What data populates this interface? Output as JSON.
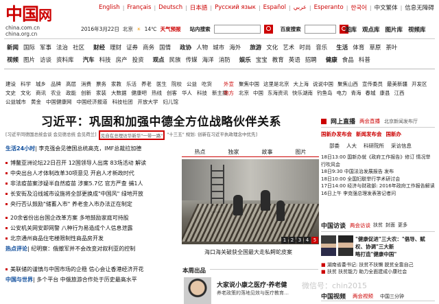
{
  "langbar": [
    "English",
    "Français",
    "Deutsch",
    "日本語",
    "Русский язык",
    "Español",
    "عربي",
    "Esperanto",
    "한국어",
    "中文繁体",
    "信息无障碍"
  ],
  "logo": {
    "main": "中国",
    "net": "网",
    "sub1": "china.com.cn",
    "sub2": "china.org.cn"
  },
  "datebar": {
    "date": "2016年3月22日",
    "city": "北京",
    "temp": "14℃",
    "weather": "天气预报",
    "site_search_label": "站内搜索",
    "baidu_label": "百度搜索"
  },
  "quicklinks": [
    "图库",
    "观点库",
    "图片库",
    "视频库"
  ],
  "nav1": [
    "新闻",
    "国际",
    "军事",
    "法治",
    "社区",
    "财经",
    "理财",
    "证券",
    "商务",
    "国情",
    "政协",
    "人物",
    "城市",
    "海外",
    "旅游",
    "文化",
    "艺术",
    "时尚",
    "音乐",
    "生活",
    "体育",
    "草原",
    "茶叶"
  ],
  "nav2": [
    "视频",
    "图片",
    "访谈",
    "资料库",
    "汽车",
    "科技",
    "房产",
    "投资",
    "观点",
    "民族",
    "传媒",
    "海洋",
    "消防",
    "娱乐",
    "宝宝",
    "教育",
    "英语",
    "招聘",
    "健康",
    "食品",
    "科普"
  ],
  "sub_left1": [
    "建设",
    "科学",
    "城乡",
    "品牌",
    "高层",
    "消费",
    "票务",
    "家教",
    "乐活",
    "养老",
    "医生",
    "院校",
    "公益",
    "吃货"
  ],
  "sub_left2": [
    "文史",
    "文化",
    "商讯",
    "农业",
    "政能",
    "创新",
    "家装",
    "大数据",
    "健康吧",
    "热线",
    "创客",
    "华人",
    "科技",
    "新主播"
  ],
  "sub_left3": [
    "公益城市",
    "黄金",
    "中国健康网",
    "中国经济报道",
    "科技社团",
    "开放大学",
    "妇儿馆"
  ],
  "sub_right1_head": "外宣",
  "sub_right1": [
    "聚焦中国",
    "这里是北京",
    "大上海",
    "说说中国",
    "聚焦山西",
    "宣传委员",
    "最美新疆",
    "开发区"
  ],
  "sub_right2_head": "地方",
  "sub_right2": [
    "北京",
    "中国",
    "东海资讯",
    "快乐湖南",
    "钓鱼岛",
    "电力",
    "青海",
    "春城",
    "康县",
    "江西"
  ],
  "headline": "习近平：巩固和加强中德全方位战略伙伴关系",
  "subheadline": {
    "pre": "[习近平同德国总统会谈 会见德总统 会见荷兰]",
    "boxed": "见自在总理访华新华\"一带一路\"",
    "post": "\"十三五\" 规划: 创新在习近平执政理念中优先]"
  },
  "news": [
    {
      "head": "生活24小时",
      "text": "| 李克强会见德国总统高克，IMF总裁拉加德"
    },
    {
      "text": "博鳌亚洲论坛22日召开 12国领导人出席 83场活动 解读"
    },
    {
      "text": "中央出台人才体制改革30项意见 开启人才新政时代"
    },
    {
      "text": "非法疫苗案涉疑半自然疫苗 涉案5.7亿 官方严查 捕1人"
    },
    {
      "text": "长安街及沿线城市设施将全部更换成\"中国风\" 绿地开放"
    },
    {
      "text": "央行否认鼓励\"储蓄入市\" 养老金入市办法正在制定"
    },
    {
      "text": "20余省份出台国企改革方案 多地鼓励家庭可持股"
    },
    {
      "text": "公安机关网安即网警 八种行为易造成个人信息泄露"
    },
    {
      "text": "北京通州商品住宅楼限制性商品房开发"
    },
    {
      "head": "热点评论",
      "text": "| 纪明察：俄撤军并不会改变对叙利亚的控制"
    },
    {
      "text": "美联储的谨慎与中国市场的企稳 信心会让香港经济开花"
    },
    {
      "head": "中国与世界",
      "text": "| 多个平台 中俄旅游合作处于历史最高水平"
    }
  ],
  "photo_tabs": [
    "热点",
    "独家",
    "故事",
    "图片"
  ],
  "photo_pages": [
    "1",
    "2",
    "3",
    "4",
    "5"
  ],
  "photo_caption": "海口海关破获全国最大走私鳄蛇皮案",
  "benzhou_label": "本周出品",
  "fangtan_text1": "大家说小康之医疗·养老健",
  "fangtan_text2": "养老政策的落地见效与医疗教育…",
  "right": {
    "live_head": "网上直播",
    "live_tag": "两会直播",
    "live_more": "北京新闻发布厅",
    "row1": [
      "国新办发布会",
      "新闻发布会",
      "国新办"
    ],
    "row2": [
      "部委",
      "人大",
      "科研院所",
      "采访信息"
    ],
    "items": [
      "18日13:00 国新办就《政府工作报告》修订 情况举行吹风会",
      "18日9:30 中国法治发展报告 发布",
      "18日10:00 全国妇联举行学术研讨会",
      "17日14:00 经济与财政部: 2016年政府工作报告解读",
      "16日上午 李克强总理发表答记者问"
    ],
    "fangtan_head": "中国访谈",
    "fangtan_tags": [
      "两会访谈",
      "扶贫",
      "封面",
      "更多"
    ],
    "fangtan_feature1": "\"健康促进\"三大农：\"倡导、赋权、协调\"三大新",
    "fangtan_feature2": "略打造\"健康中国\"",
    "ad1": "湖南省委书记: 扶贫不扶懒 脱贫全靠自己",
    "ad2": "扶贫 扶贫能力 助力全面建成小康社会",
    "video_head": "中国视频",
    "video_tag": "两会视频",
    "video_more": "中国三分钟"
  },
  "watermark": "微信号：chin2015"
}
